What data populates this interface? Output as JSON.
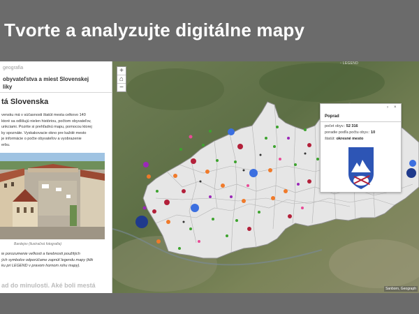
{
  "slide": {
    "title": "Tvorte a analyzujte digitálne mapy"
  },
  "sidebar": {
    "crumb": "geografia",
    "story_title_line1": "obyvateľstva a miest Slovenskej",
    "story_title_line2": "liky",
    "section_title": "tá Slovenska",
    "paragraph": [
      "vensku má v súčasnosti štatút mesta celkovo 140",
      "ktoré sa odlišujú nielen históriou, počtom obyvateľov,",
      "unkciami. Pozrite si prehľadnú mapu, pomocou ktorej",
      "ky spoznáte. Vyskakovacie okno pre každé mesto",
      "je informácie o počte obyvateľov a vyobrazenie",
      "erbu."
    ],
    "photo_caption": "Bardejov (ilustračná fotografia)",
    "note": [
      "ie porozumenie veľkosti a farebnosti použitých",
      "ých symbolov odporúčame zapnúť legendu mapy (klik",
      "ku pri LEGEND v pravom hornom rohu mapy)."
    ],
    "faded_heading": "ad do minulosti. Aké boli mestá"
  },
  "map": {
    "zoom_in": "+",
    "home": "⌂",
    "zoom_out": "−",
    "legend_label": "LEGEND",
    "attribution": "Sanborn, Geograph",
    "colors": {
      "land": "#e6e6e6",
      "border": "#9a9a9a",
      "large_city": "#3b6fe0",
      "capital": "#1f3a8c",
      "red": "#b3203a",
      "orange": "#f07a2a",
      "green": "#3da32e",
      "purple": "#9b28b8",
      "pink": "#e84b96"
    }
  },
  "popup": {
    "title": "Poprad",
    "row1_label": "počet obyv.: ",
    "row1_value": "52 316",
    "row2_label": "poradie podľa počtu obyv.: ",
    "row2_value": "10",
    "row3_label": "štatút: ",
    "row3_value": "okresné mesto",
    "next_icon": "›",
    "close_icon": "×"
  }
}
